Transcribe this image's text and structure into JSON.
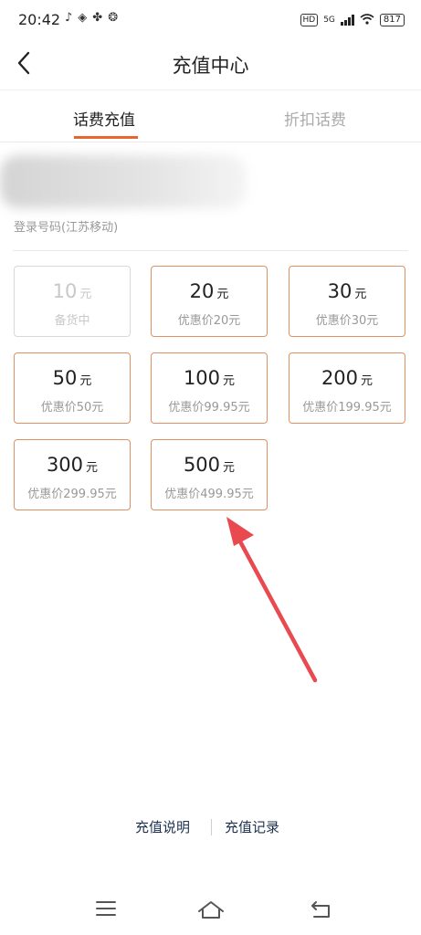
{
  "statusbar": {
    "time": "20:42",
    "left_icons": [
      "tiktok-icon",
      "app-icon",
      "app-icon",
      "weibo-icon"
    ],
    "hd": "HD",
    "network": "5G",
    "battery": "817"
  },
  "header": {
    "title": "充值中心",
    "back_icon": "chevron-left-icon"
  },
  "tabs": [
    {
      "label": "话费充值",
      "active": true
    },
    {
      "label": "折扣话费",
      "active": false
    }
  ],
  "account": {
    "phone_label": "登录号码(江苏移动)"
  },
  "cards": [
    {
      "amount": "10",
      "unit": "元",
      "sub": "备货中",
      "disabled": true
    },
    {
      "amount": "20",
      "unit": "元",
      "sub": "优惠价20元"
    },
    {
      "amount": "30",
      "unit": "元",
      "sub": "优惠价30元"
    },
    {
      "amount": "50",
      "unit": "元",
      "sub": "优惠价50元"
    },
    {
      "amount": "100",
      "unit": "元",
      "sub": "优惠价99.95元"
    },
    {
      "amount": "200",
      "unit": "元",
      "sub": "优惠价199.95元"
    },
    {
      "amount": "300",
      "unit": "元",
      "sub": "优惠价299.95元"
    },
    {
      "amount": "500",
      "unit": "元",
      "sub": "优惠价499.95元"
    }
  ],
  "links": {
    "instructions": "充值说明",
    "records": "充值记录"
  },
  "colors": {
    "accent": "#e8662e",
    "card_border": "#e0915f",
    "annotation": "#e84a4f"
  }
}
